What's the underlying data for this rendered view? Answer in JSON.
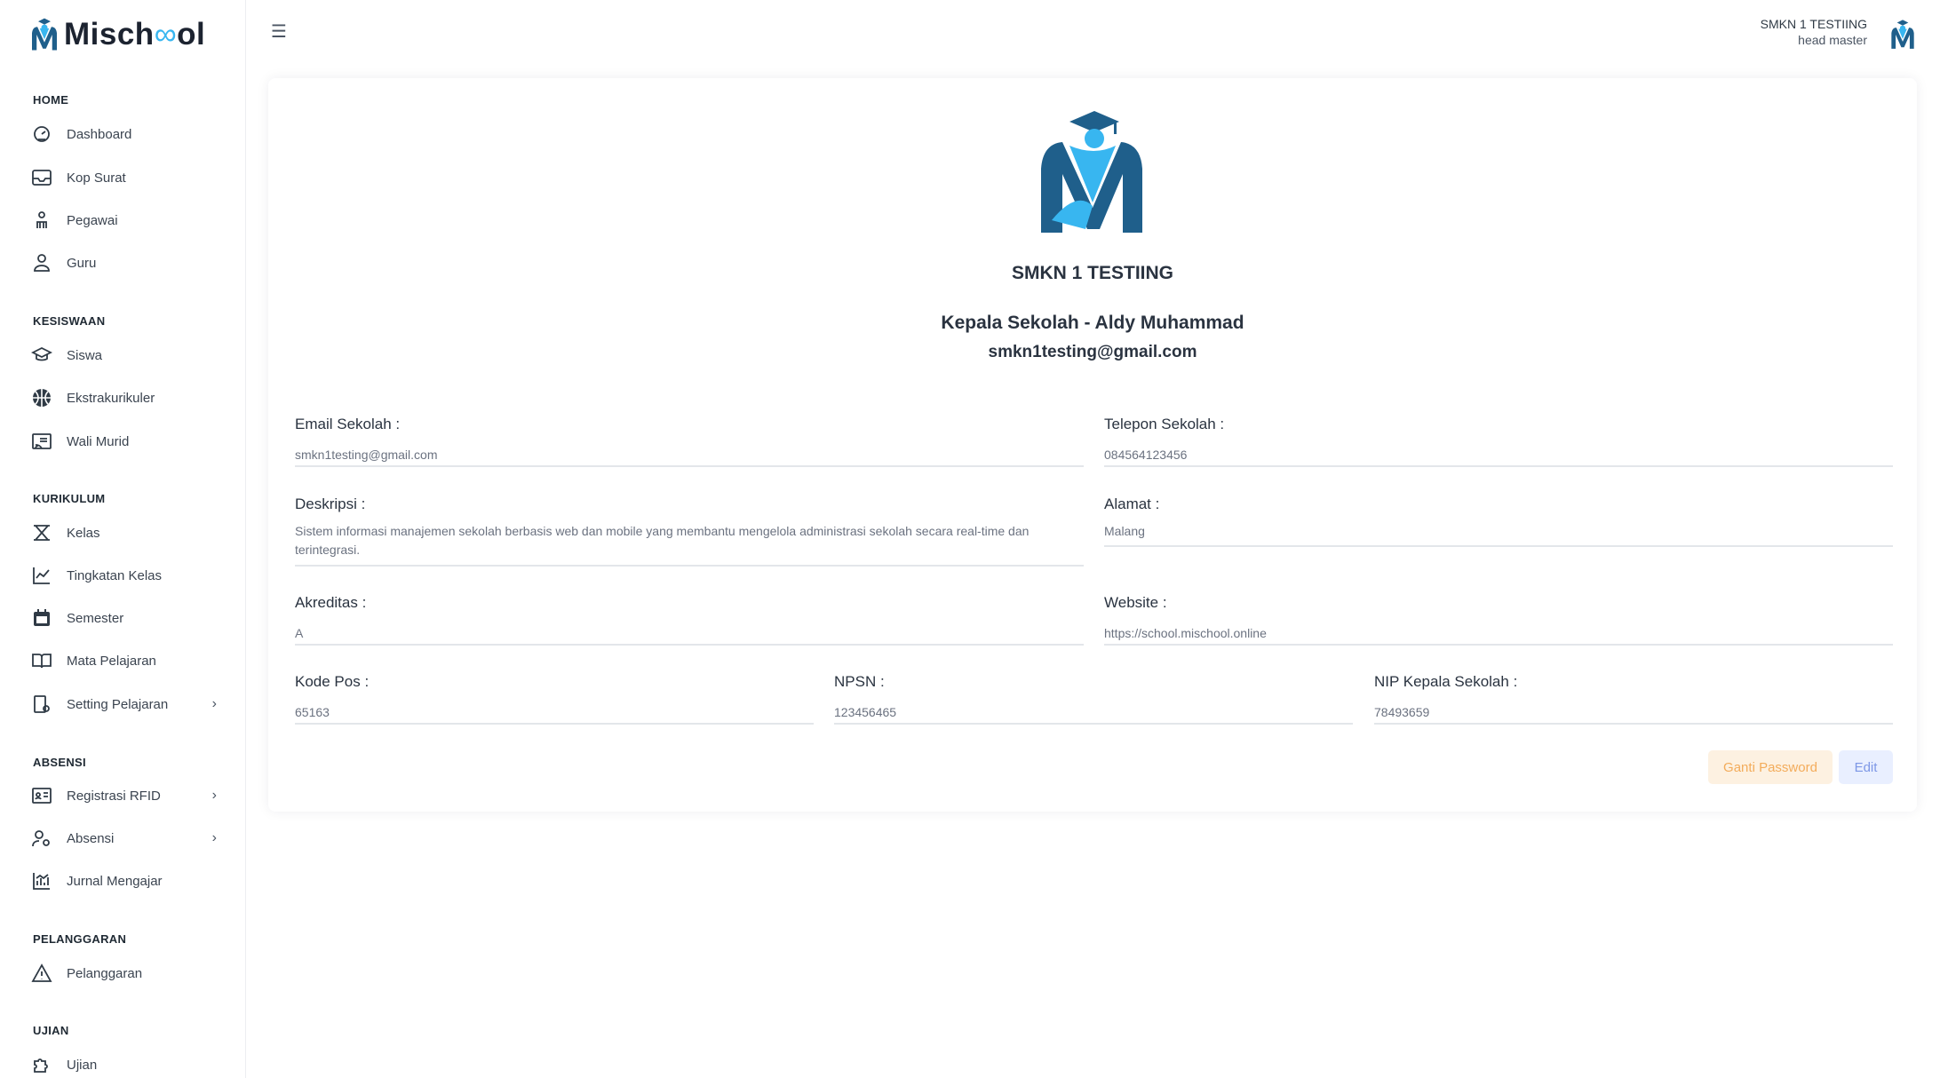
{
  "app": {
    "logo_text_1": "Misch",
    "logo_text_2": "ol",
    "brand_colors": {
      "dark_blue": "#1f5f8b",
      "light_blue": "#38b6f0"
    }
  },
  "sidebar": {
    "sections": [
      {
        "title": "HOME",
        "items": [
          {
            "label": "Dashboard",
            "icon": "dashboard-icon"
          },
          {
            "label": "Kop Surat",
            "icon": "inbox-icon"
          },
          {
            "label": "Pegawai",
            "icon": "employee-icon"
          },
          {
            "label": "Guru",
            "icon": "teacher-icon"
          }
        ]
      },
      {
        "title": "KESISWAAN",
        "items": [
          {
            "label": "Siswa",
            "icon": "graduation-cap-icon"
          },
          {
            "label": "Ekstrakurikuler",
            "icon": "basketball-icon"
          },
          {
            "label": "Wali Murid",
            "icon": "cast-icon"
          }
        ]
      },
      {
        "title": "KURIKULUM",
        "items": [
          {
            "label": "Kelas",
            "icon": "class-icon"
          },
          {
            "label": "Tingkatan Kelas",
            "icon": "chart-line-icon"
          },
          {
            "label": "Semester",
            "icon": "calendar-icon"
          },
          {
            "label": "Mata Pelajaran",
            "icon": "book-icon"
          },
          {
            "label": "Setting Pelajaran",
            "icon": "settings-doc-icon",
            "chevron": "›"
          }
        ]
      },
      {
        "title": "ABSENSI",
        "items": [
          {
            "label": "Registrasi RFID",
            "icon": "id-card-icon",
            "chevron": "›"
          },
          {
            "label": "Absensi",
            "icon": "user-gear-icon",
            "chevron": "›"
          },
          {
            "label": "Jurnal Mengajar",
            "icon": "journal-chart-icon"
          }
        ]
      },
      {
        "title": "PELANGGARAN",
        "items": [
          {
            "label": "Pelanggaran",
            "icon": "warning-icon"
          }
        ]
      },
      {
        "title": "UJIAN",
        "items": [
          {
            "label": "Ujian",
            "icon": "puzzle-icon"
          }
        ]
      }
    ]
  },
  "topbar": {
    "menu_icon": "☰",
    "user_name": "SMKN 1 TESTIING",
    "user_role": "head master"
  },
  "profile": {
    "school_name": "SMKN 1 TESTIING",
    "head_title": "Kepala Sekolah - Aldy Muhammad",
    "email": "smkn1testing@gmail.com",
    "fields": {
      "email_sekolah": {
        "label": "Email Sekolah :",
        "value": "smkn1testing@gmail.com"
      },
      "telepon_sekolah": {
        "label": "Telepon Sekolah :",
        "value": "084564123456"
      },
      "deskripsi": {
        "label": "Deskripsi :",
        "value": "Sistem informasi manajemen sekolah berbasis web dan mobile yang membantu mengelola administrasi sekolah secara real-time dan terintegrasi."
      },
      "alamat": {
        "label": "Alamat :",
        "value": "Malang"
      },
      "akreditas": {
        "label": "Akreditas :",
        "value": "A"
      },
      "website": {
        "label": "Website :",
        "value": "https://school.mischool.online"
      },
      "kode_pos": {
        "label": "Kode Pos :",
        "value": "65163"
      },
      "npsn": {
        "label": "NPSN :",
        "value": "123456465"
      },
      "nip_kepala": {
        "label": "NIP Kepala Sekolah :",
        "value": "78493659"
      }
    },
    "buttons": {
      "ganti_password": "Ganti Password",
      "edit": "Edit"
    }
  }
}
